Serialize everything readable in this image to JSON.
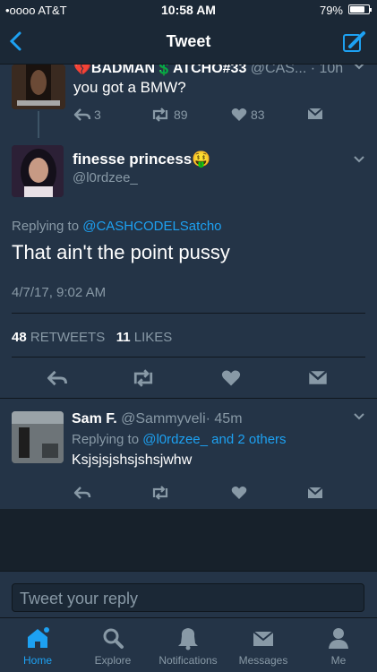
{
  "status_bar": {
    "carrier": "•oooo AT&T",
    "time": "10:58 AM",
    "battery": "79%",
    "battery_level": 0.79
  },
  "nav": {
    "title": "Tweet"
  },
  "thread_top": {
    "name": "💔BADMAN💲ATCHO#33",
    "handle": "@CAS...",
    "time": "· 10h",
    "text": "you got a BMW?",
    "replies": "3",
    "retweets": "89",
    "likes": "83"
  },
  "main_tweet": {
    "name": "finesse princess🤑",
    "handle": "@l0rdzee_",
    "replying_prefix": "Replying to",
    "replying_to": "@CASHCODELSatcho",
    "text": "That ain't the point pussy",
    "date": "4/7/17, 9:02 AM",
    "retweets_count": "48",
    "retweets_label": "RETWEETS",
    "likes_count": "11",
    "likes_label": "LIKES"
  },
  "reply_tweet": {
    "name": "Sam F.",
    "handle": "@Sammyveli",
    "time": "· 45m",
    "replying_prefix": "Replying to",
    "replying_to": "@l0rdzee_ and 2 others",
    "text": "Ksjsjsjshsjshsjwhw"
  },
  "composer": {
    "placeholder": "Tweet your reply"
  },
  "tabs": [
    {
      "label": "Home",
      "icon": "home-icon"
    },
    {
      "label": "Explore",
      "icon": "search-icon"
    },
    {
      "label": "Notifications",
      "icon": "bell-icon"
    },
    {
      "label": "Messages",
      "icon": "envelope-icon"
    },
    {
      "label": "Me",
      "icon": "person-icon"
    }
  ],
  "colors": {
    "accent": "#1da1f2",
    "background": "#1b2836",
    "card": "#243447",
    "muted": "#8899a6"
  }
}
